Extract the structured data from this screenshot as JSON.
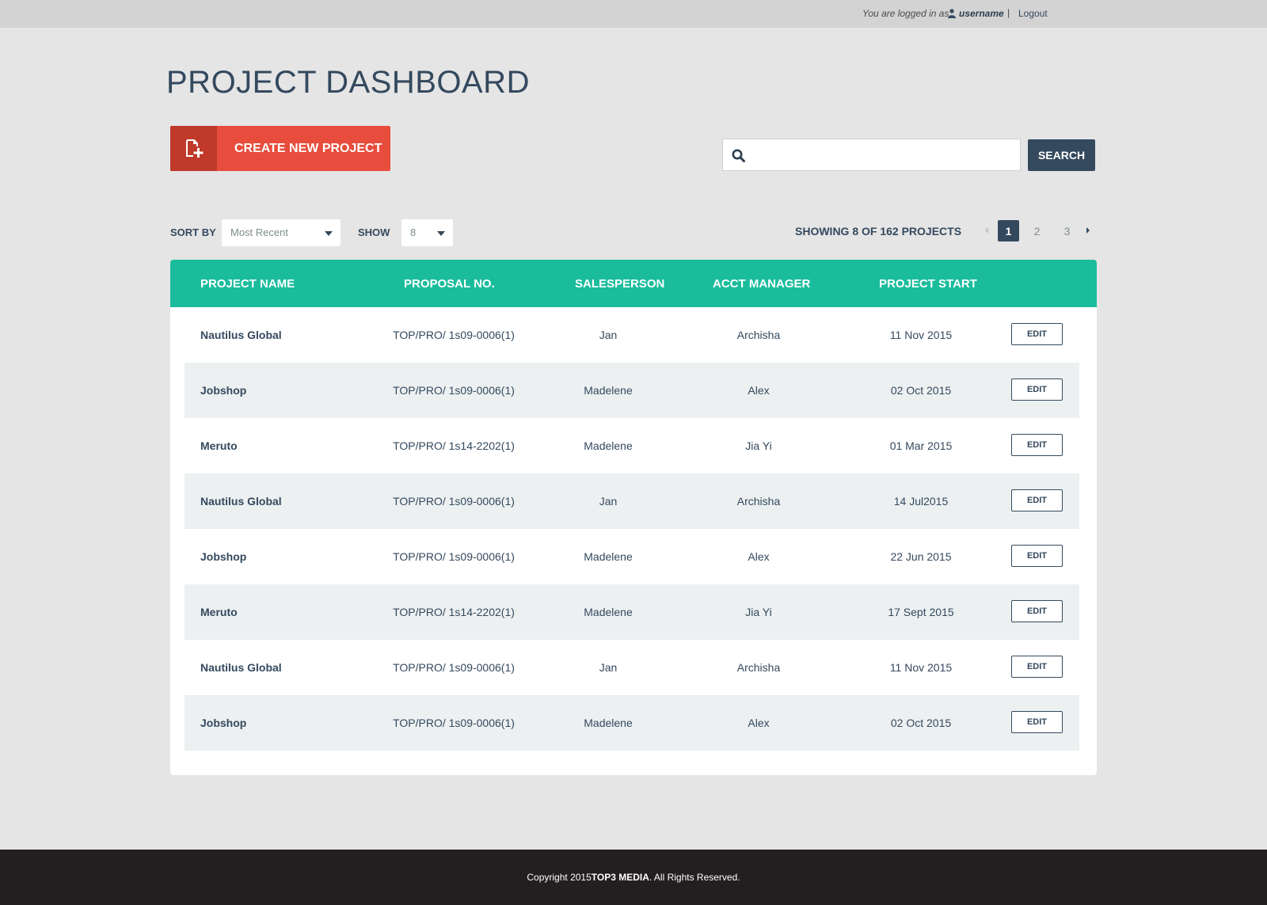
{
  "topbar": {
    "login_text": "You are logged in as",
    "username": "username",
    "separator": "|",
    "logout": "Logout"
  },
  "page": {
    "title": "PROJECT DASHBOARD"
  },
  "actions": {
    "create_label": "CREATE NEW PROJECT",
    "search_placeholder": "",
    "search_label": "SEARCH"
  },
  "controls": {
    "sort_label": "SORT BY",
    "sort_value": "Most Recent",
    "show_label": "SHOW",
    "show_value": "8",
    "showing_text": "SHOWING 8 OF 162 PROJECTS",
    "pages": [
      "1",
      "2",
      "3"
    ],
    "current_page": "1"
  },
  "table": {
    "headers": [
      "PROJECT NAME",
      "PROPOSAL NO.",
      "SALESPERSON",
      "ACCT MANAGER",
      "PROJECT START"
    ],
    "edit_label": "EDIT",
    "rows": [
      {
        "name": "Nautilus Global",
        "proposal": "TOP/PRO/  1s09-0006(1)",
        "salesperson": "Jan",
        "manager": "Archisha",
        "start": "11 Nov 2015"
      },
      {
        "name": "Jobshop",
        "proposal": "TOP/PRO/  1s09-0006(1)",
        "salesperson": "Madelene",
        "manager": "Alex",
        "start": "02 Oct 2015"
      },
      {
        "name": "Meruto",
        "proposal": "TOP/PRO/  1s14-2202(1)",
        "salesperson": "Madelene",
        "manager": "Jia Yi",
        "start": "01 Mar 2015"
      },
      {
        "name": "Nautilus Global",
        "proposal": "TOP/PRO/  1s09-0006(1)",
        "salesperson": "Jan",
        "manager": "Archisha",
        "start": "14 Jul2015"
      },
      {
        "name": "Jobshop",
        "proposal": "TOP/PRO/  1s09-0006(1)",
        "salesperson": "Madelene",
        "manager": "Alex",
        "start": "22 Jun 2015"
      },
      {
        "name": "Meruto",
        "proposal": "TOP/PRO/  1s14-2202(1)",
        "salesperson": "Madelene",
        "manager": "Jia Yi",
        "start": "17 Sept 2015"
      },
      {
        "name": "Nautilus Global",
        "proposal": "TOP/PRO/  1s09-0006(1)",
        "salesperson": "Jan",
        "manager": "Archisha",
        "start": "11 Nov 2015"
      },
      {
        "name": "Jobshop",
        "proposal": "TOP/PRO/  1s09-0006(1)",
        "salesperson": "Madelene",
        "manager": "Alex",
        "start": "02 Oct 2015"
      }
    ]
  },
  "footer": {
    "prefix": "Copyright 2015 ",
    "brand": "TOP3 MEDIA",
    "suffix": ". All Rights Reserved."
  },
  "colors": {
    "accent_red": "#e74c3c",
    "accent_red_dark": "#c0392b",
    "teal_header": "#1abc9c",
    "navy": "#34495e",
    "footer_bg": "#231f20"
  },
  "icons": {
    "user": "user-icon",
    "new_file": "new-file-icon",
    "search": "search-icon",
    "caret": "caret-down-icon",
    "prev": "chevron-left-icon",
    "next": "chevron-right-icon"
  }
}
